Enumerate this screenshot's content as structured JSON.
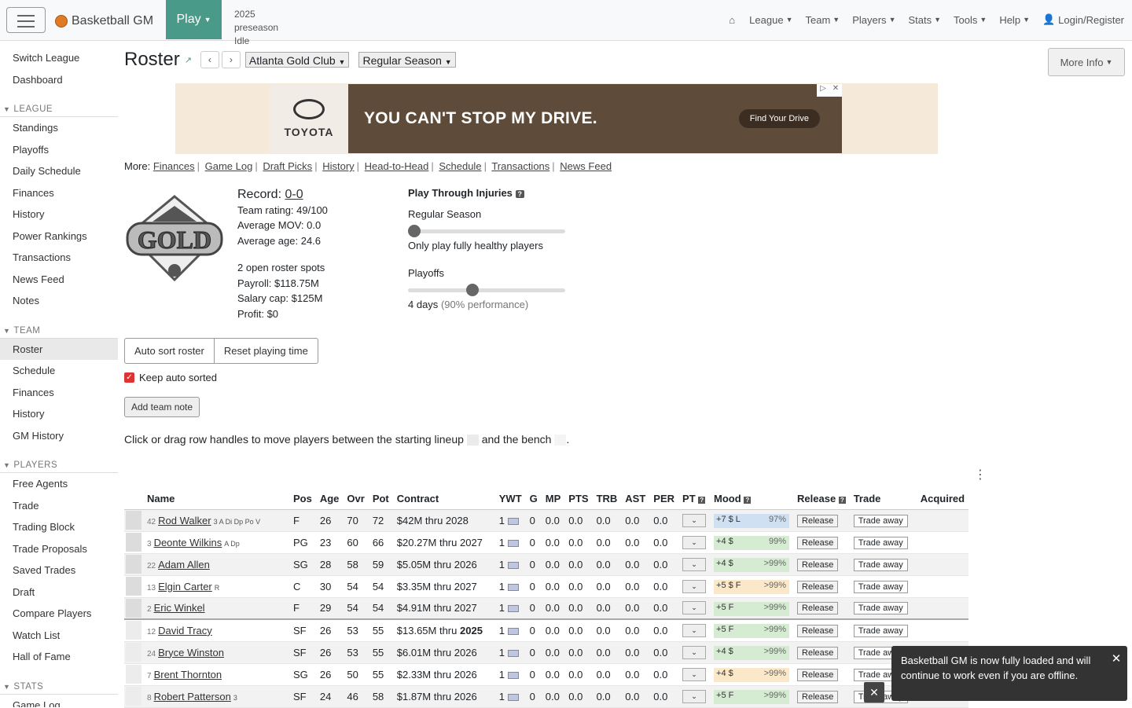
{
  "nav": {
    "brand": "Basketball GM",
    "play": "Play",
    "season_line1": "2025 preseason",
    "season_line2": "Idle",
    "items": [
      "League",
      "Team",
      "Players",
      "Stats",
      "Tools",
      "Help"
    ],
    "login": "Login/Register"
  },
  "sidebar": {
    "top": [
      "Switch League",
      "Dashboard"
    ],
    "league_head": "LEAGUE",
    "league": [
      "Standings",
      "Playoffs",
      "Daily Schedule",
      "Finances",
      "History",
      "Power Rankings",
      "Transactions",
      "News Feed",
      "Notes"
    ],
    "team_head": "TEAM",
    "team": [
      "Roster",
      "Schedule",
      "Finances",
      "History",
      "GM History"
    ],
    "players_head": "PLAYERS",
    "players": [
      "Free Agents",
      "Trade",
      "Trading Block",
      "Trade Proposals",
      "Saved Trades",
      "Draft",
      "Compare Players",
      "Watch List",
      "Hall of Fame"
    ],
    "stats_head": "STATS",
    "stats": [
      "Game Log"
    ]
  },
  "page": {
    "title": "Roster",
    "team_select": "Atlanta Gold Club",
    "season_select": "Regular Season",
    "more_info": "More Info"
  },
  "ad": {
    "brand": "TOYOTA",
    "headline": "YOU CAN'T STOP MY DRIVE.",
    "cta": "Find Your Drive"
  },
  "more_links": {
    "label": "More:",
    "links": [
      "Finances",
      "Game Log",
      "Draft Picks",
      "History",
      "Head-to-Head",
      "Schedule",
      "Transactions",
      "News Feed"
    ]
  },
  "team_info": {
    "record_label": "Record: ",
    "record": "0-0",
    "rating": "Team rating: 49/100",
    "mov": "Average MOV: 0.0",
    "age": "Average age: 24.6",
    "roster_spots": "2 open roster spots",
    "payroll": "Payroll: $118.75M",
    "salary_cap": "Salary cap: $125M",
    "profit": "Profit: $0"
  },
  "injuries": {
    "title": "Play Through Injuries",
    "regular_label": "Regular Season",
    "regular_value": 0,
    "regular_desc": "Only play fully healthy players",
    "playoffs_label": "Playoffs",
    "playoffs_value": 4,
    "playoffs_desc": "4 days",
    "playoffs_perf": "(90% performance)"
  },
  "buttons": {
    "auto_sort": "Auto sort roster",
    "reset_pt": "Reset playing time",
    "keep_sorted": "Keep auto sorted",
    "team_note": "Add team note"
  },
  "drag_help": {
    "text1": "Click or drag row handles to move players between the starting lineup",
    "text2": "and the bench",
    "text3": "."
  },
  "table": {
    "headers": [
      "Name",
      "Pos",
      "Age",
      "Ovr",
      "Pot",
      "Contract",
      "YWT",
      "G",
      "MP",
      "PTS",
      "TRB",
      "AST",
      "PER",
      "PT",
      "Mood",
      "Release",
      "Trade",
      "Acquired"
    ],
    "rows": [
      {
        "num": "42",
        "name": "Rod Walker",
        "skills": "3 A Di Dp Po V",
        "pos": "F",
        "age": "26",
        "ovr": "70",
        "pot": "72",
        "contract": "$42M thru 2028",
        "ywt": "1",
        "g": "0",
        "mp": "0.0",
        "pts": "0.0",
        "trb": "0.0",
        "ast": "0.0",
        "per": "0.0",
        "mood": "+7 $ L",
        "mood_pct": "97%",
        "release": "Release",
        "trade": "Trade away"
      },
      {
        "num": "3",
        "name": "Deonte Wilkins",
        "skills": "A Dp",
        "pos": "PG",
        "age": "23",
        "ovr": "60",
        "pot": "66",
        "contract": "$20.27M thru 2027",
        "ywt": "1",
        "g": "0",
        "mp": "0.0",
        "pts": "0.0",
        "trb": "0.0",
        "ast": "0.0",
        "per": "0.0",
        "mood": "+4 $",
        "mood_pct": "99%",
        "release": "Release",
        "trade": "Trade away"
      },
      {
        "num": "22",
        "name": "Adam Allen",
        "skills": "",
        "pos": "SG",
        "age": "28",
        "ovr": "58",
        "pot": "59",
        "contract": "$5.05M thru 2026",
        "ywt": "1",
        "g": "0",
        "mp": "0.0",
        "pts": "0.0",
        "trb": "0.0",
        "ast": "0.0",
        "per": "0.0",
        "mood": "+4 $",
        "mood_pct": ">99%",
        "release": "Release",
        "trade": "Trade away"
      },
      {
        "num": "13",
        "name": "Elgin Carter",
        "skills": "R",
        "pos": "C",
        "age": "30",
        "ovr": "54",
        "pot": "54",
        "contract": "$3.35M thru 2027",
        "ywt": "1",
        "g": "0",
        "mp": "0.0",
        "pts": "0.0",
        "trb": "0.0",
        "ast": "0.0",
        "per": "0.0",
        "mood": "+5 $ F",
        "mood_pct": ">99%",
        "release": "Release",
        "trade": "Trade away"
      },
      {
        "num": "2",
        "name": "Eric Winkel",
        "skills": "",
        "pos": "F",
        "age": "29",
        "ovr": "54",
        "pot": "54",
        "contract": "$4.91M thru 2027",
        "ywt": "1",
        "g": "0",
        "mp": "0.0",
        "pts": "0.0",
        "trb": "0.0",
        "ast": "0.0",
        "per": "0.0",
        "mood": "+5 F",
        "mood_pct": ">99%",
        "release": "Release",
        "trade": "Trade away"
      },
      {
        "num": "12",
        "name": "David Tracy",
        "skills": "",
        "pos": "SF",
        "age": "26",
        "ovr": "53",
        "pot": "55",
        "contract": "$13.65M thru",
        "contract_year": "2025",
        "ywt": "1",
        "g": "0",
        "mp": "0.0",
        "pts": "0.0",
        "trb": "0.0",
        "ast": "0.0",
        "per": "0.0",
        "mood": "+5 F",
        "mood_pct": ">99%",
        "release": "Release",
        "trade": "Trade away"
      },
      {
        "num": "24",
        "name": "Bryce Winston",
        "skills": "",
        "pos": "SF",
        "age": "26",
        "ovr": "53",
        "pot": "55",
        "contract": "$6.01M thru 2026",
        "ywt": "1",
        "g": "0",
        "mp": "0.0",
        "pts": "0.0",
        "trb": "0.0",
        "ast": "0.0",
        "per": "0.0",
        "mood": "+4 $",
        "mood_pct": ">99%",
        "release": "Release",
        "trade": "Trade away"
      },
      {
        "num": "7",
        "name": "Brent Thornton",
        "skills": "",
        "pos": "SG",
        "age": "26",
        "ovr": "50",
        "pot": "55",
        "contract": "$2.33M thru 2026",
        "ywt": "1",
        "g": "0",
        "mp": "0.0",
        "pts": "0.0",
        "trb": "0.0",
        "ast": "0.0",
        "per": "0.0",
        "mood": "+4 $",
        "mood_pct": ">99%",
        "release": "Release",
        "trade": "Trade away"
      },
      {
        "num": "8",
        "name": "Robert Patterson",
        "skills": "3",
        "pos": "SF",
        "age": "24",
        "ovr": "46",
        "pot": "58",
        "contract": "$1.87M thru 2026",
        "ywt": "1",
        "g": "0",
        "mp": "0.0",
        "pts": "0.0",
        "trb": "0.0",
        "ast": "0.0",
        "per": "0.0",
        "mood": "+5 F",
        "mood_pct": ">99%",
        "release": "Release",
        "trade": "Trade away"
      }
    ]
  },
  "toast": {
    "text": "Basketball GM is now fully loaded and will continue to work even if you are offline."
  }
}
